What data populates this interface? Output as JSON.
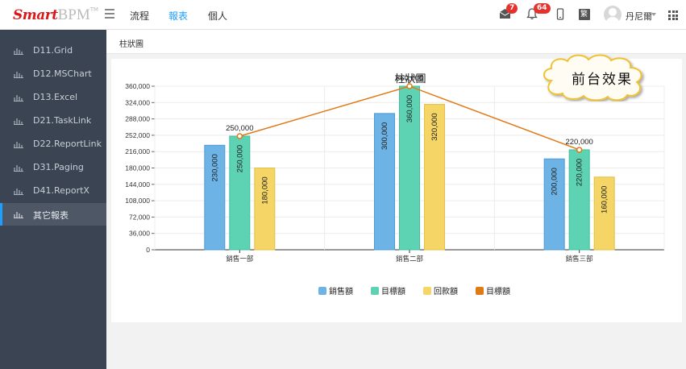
{
  "logo": {
    "smart": "Smart",
    "bpm": "BPM",
    "tm": "TM"
  },
  "nav": [
    {
      "label": "流程",
      "active": false
    },
    {
      "label": "報表",
      "active": true
    },
    {
      "label": "個人",
      "active": false
    }
  ],
  "header_icons": {
    "mail_badge": "7",
    "bell_badge": "64",
    "lang_label": "繁"
  },
  "user": {
    "name": "丹尼爾"
  },
  "sidebar": {
    "items": [
      {
        "label": "D11.Grid",
        "active": false
      },
      {
        "label": "D12.MSChart",
        "active": false
      },
      {
        "label": "D13.Excel",
        "active": false
      },
      {
        "label": "D21.TaskLink",
        "active": false
      },
      {
        "label": "D22.ReportLink",
        "active": false
      },
      {
        "label": "D31.Paging",
        "active": false
      },
      {
        "label": "D41.ReportX",
        "active": false
      },
      {
        "label": "其它報表",
        "active": true
      }
    ]
  },
  "breadcrumb": "柱狀圖",
  "callout": "前台效果",
  "colors": {
    "sales": "#6db3e5",
    "target": "#5dd3b3",
    "collection": "#f4d565",
    "line": "#e07a17",
    "sidebar_bg": "#3a4452",
    "accent": "#1e9fff"
  },
  "chart_data": {
    "type": "bar",
    "title": "柱狀圖",
    "categories": [
      "銷售一部",
      "銷售二部",
      "銷售三部"
    ],
    "series": [
      {
        "name": "銷售額",
        "type": "bar",
        "values": [
          230000,
          300000,
          200000
        ]
      },
      {
        "name": "目標額",
        "type": "bar",
        "values": [
          250000,
          360000,
          220000
        ]
      },
      {
        "name": "回款額",
        "type": "bar",
        "values": [
          180000,
          320000,
          160000
        ]
      },
      {
        "name": "目標額",
        "type": "line",
        "values": [
          250000,
          360000,
          220000
        ]
      }
    ],
    "ylim": [
      0,
      360000
    ],
    "yticks": [
      "0",
      "36,000",
      "72,000",
      "108,000",
      "144,000",
      "180,000",
      "216,000",
      "252,000",
      "288,000",
      "324,000",
      "360,000"
    ],
    "bar_labels": [
      [
        "230,000",
        "250,000",
        "180,000"
      ],
      [
        "300,000",
        "360,000",
        "320,000"
      ],
      [
        "200,000",
        "220,000",
        "160,000"
      ]
    ],
    "line_labels": [
      "250,000",
      "360,000",
      "220,000"
    ],
    "grid": true,
    "legend": "bottom-center"
  }
}
